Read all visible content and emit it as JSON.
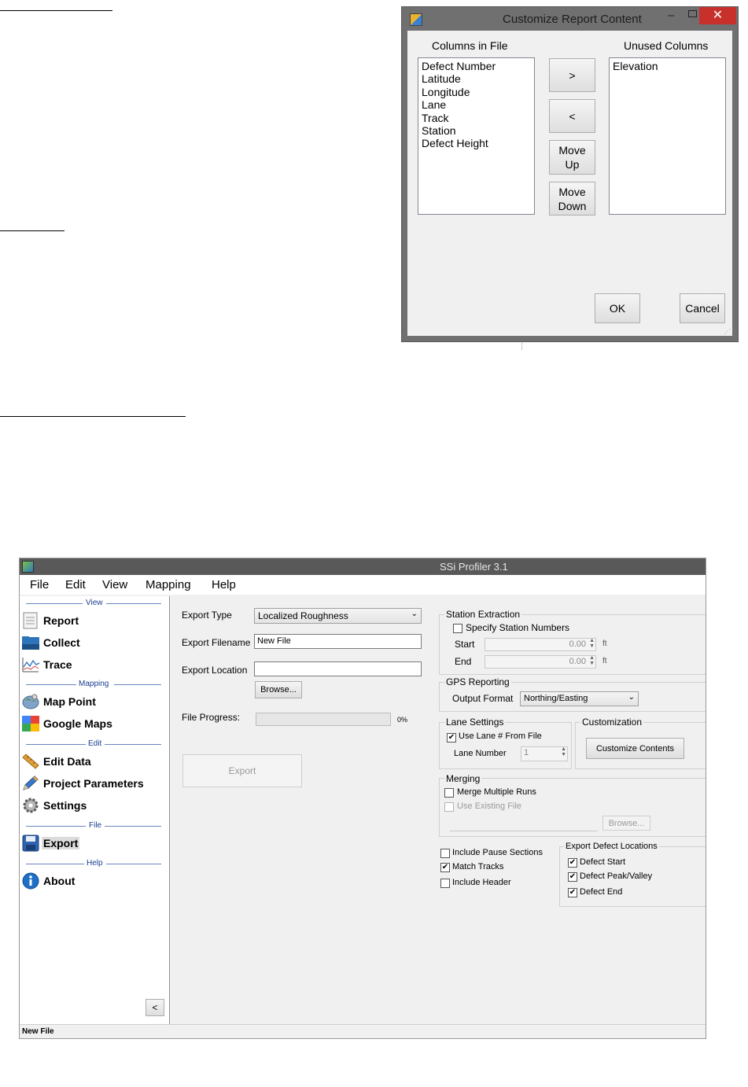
{
  "dialog": {
    "title": "Customize Report Content",
    "close_glyph": "✕",
    "minimize_glyph": "–",
    "columns_in_file_label": "Columns in File",
    "unused_columns_label": "Unused Columns",
    "columns_in_file": [
      "Defect Number",
      "Latitude",
      "Longitude",
      "Lane",
      "Track",
      "Station",
      "Defect Height"
    ],
    "unused_columns": [
      "Elevation"
    ],
    "buttons": {
      "move_right": ">",
      "move_left": "<",
      "move_up": "Move Up",
      "move_down": "Move Down",
      "ok": "OK",
      "cancel": "Cancel"
    }
  },
  "app": {
    "title": "SSi Profiler 3.1",
    "menu": [
      "File",
      "Edit",
      "View",
      "Mapping",
      "Help"
    ],
    "nav": {
      "sections": {
        "view": "View",
        "mapping": "Mapping",
        "edit": "Edit",
        "file": "File",
        "help": "Help"
      },
      "items": {
        "report": "Report",
        "collect": "Collect",
        "trace": "Trace",
        "map_point": "Map Point",
        "google_maps": "Google Maps",
        "edit_data": "Edit Data",
        "project_parameters": "Project Parameters",
        "settings": "Settings",
        "export": "Export",
        "about": "About"
      },
      "collapse_label": "<"
    },
    "export_form": {
      "export_type_label": "Export Type",
      "export_type_value": "Localized Roughness",
      "export_filename_label": "Export Filename",
      "export_filename_value": "New File",
      "export_location_label": "Export Location",
      "export_location_value": "",
      "browse_label": "Browse...",
      "file_progress_label": "File Progress:",
      "file_progress_percent": "0%",
      "file_progress_fraction": 0,
      "export_button": "Export"
    },
    "station_extraction": {
      "title": "Station Extraction",
      "specify_label": "Specify Station Numbers",
      "specify_checked": false,
      "start_label": "Start",
      "start_value": "0.00",
      "end_label": "End",
      "end_value": "0.00",
      "unit": "ft"
    },
    "gps_reporting": {
      "title": "GPS Reporting",
      "output_format_label": "Output Format",
      "output_format_value": "Northing/Easting"
    },
    "lane_settings": {
      "title": "Lane Settings",
      "use_lane_label": "Use Lane # From File",
      "use_lane_checked": true,
      "lane_number_label": "Lane Number",
      "lane_number_value": "1"
    },
    "customization": {
      "title": "Customization",
      "button": "Customize Contents"
    },
    "merging": {
      "title": "Merging",
      "merge_label": "Merge Multiple Runs",
      "merge_checked": false,
      "use_existing_label": "Use Existing File",
      "use_existing_checked": false,
      "browse_label": "Browse..."
    },
    "options": {
      "include_pause": "Include Pause Sections",
      "include_pause_checked": false,
      "match_tracks": "Match Tracks",
      "match_tracks_checked": true,
      "include_header": "Include Header",
      "include_header_checked": false
    },
    "defect_locations": {
      "title": "Export Defect Locations",
      "start": "Defect Start",
      "peak": "Defect Peak/Valley",
      "end": "Defect End"
    },
    "status": "New File",
    "check_glyph": "✔"
  }
}
